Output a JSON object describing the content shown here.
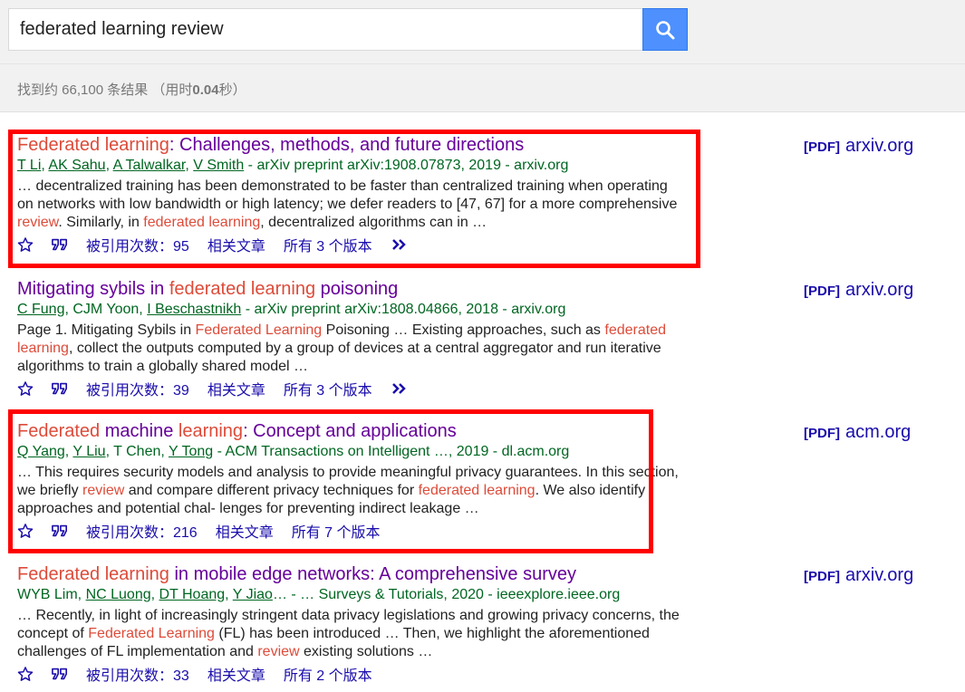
{
  "search": {
    "query": "federated learning review"
  },
  "stats": {
    "prefix": "找到约 66,100 条结果 （用时",
    "time": "0.04",
    "suffix": "秒）"
  },
  "results": [
    {
      "title": [
        {
          "t": "Federated learning",
          "hl": true
        },
        {
          "t": ": Challenges, methods, and future directions",
          "hl": false
        }
      ],
      "authors": [
        {
          "t": "T Li",
          "u": true
        },
        {
          "t": ", ",
          "u": false
        },
        {
          "t": "AK Sahu",
          "u": true
        },
        {
          "t": ", ",
          "u": false
        },
        {
          "t": "A Talwalkar",
          "u": true
        },
        {
          "t": ", ",
          "u": false
        },
        {
          "t": "V Smith",
          "u": true
        },
        {
          "t": " - arXiv preprint arXiv:1908.07873, 2019 - arxiv.org",
          "u": false
        }
      ],
      "snippet": [
        {
          "t": "… decentralized training has been demonstrated to be faster than centralized training when operating on networks with low bandwidth or high latency; we defer readers to [47, 67] for a more comprehensive ",
          "hl": false
        },
        {
          "t": "review",
          "hl": true
        },
        {
          "t": ". Similarly, in ",
          "hl": false
        },
        {
          "t": "federated learning",
          "hl": true
        },
        {
          "t": ", decentralized algorithms can in …",
          "hl": false
        }
      ],
      "cited": "被引用次数：95",
      "related": "相关文章",
      "versions": "所有 3 个版本",
      "more": true,
      "pdf_tag": "[PDF]",
      "pdf_host": "arxiv.org"
    },
    {
      "title": [
        {
          "t": "Mitigating sybils in ",
          "hl": false
        },
        {
          "t": "federated learning",
          "hl": true
        },
        {
          "t": " poisoning",
          "hl": false
        }
      ],
      "authors": [
        {
          "t": "C Fung",
          "u": true
        },
        {
          "t": ", CJM Yoon, ",
          "u": false
        },
        {
          "t": "I Beschastnikh",
          "u": true
        },
        {
          "t": " - arXiv preprint arXiv:1808.04866, 2018 - arxiv.org",
          "u": false
        }
      ],
      "snippet": [
        {
          "t": "Page 1. Mitigating Sybils in ",
          "hl": false
        },
        {
          "t": "Federated Learning",
          "hl": true
        },
        {
          "t": " Poisoning … Existing approaches, such as ",
          "hl": false
        },
        {
          "t": "federated learning",
          "hl": true
        },
        {
          "t": ", collect the outputs computed by a group of devices at a central aggregator and run iterative algorithms to train a globally shared model …",
          "hl": false
        }
      ],
      "cited": "被引用次数：39",
      "related": "相关文章",
      "versions": "所有 3 个版本",
      "more": true,
      "pdf_tag": "[PDF]",
      "pdf_host": "arxiv.org"
    },
    {
      "title": [
        {
          "t": "Federated",
          "hl": true
        },
        {
          "t": " machine ",
          "hl": false
        },
        {
          "t": "learning",
          "hl": true
        },
        {
          "t": ": Concept and applications",
          "hl": false
        }
      ],
      "authors": [
        {
          "t": "Q Yang",
          "u": true
        },
        {
          "t": ", ",
          "u": false
        },
        {
          "t": "Y Liu",
          "u": true
        },
        {
          "t": ", T Chen, ",
          "u": false
        },
        {
          "t": "Y Tong",
          "u": true
        },
        {
          "t": " - ACM Transactions on Intelligent …, 2019 - dl.acm.org",
          "u": false
        }
      ],
      "snippet": [
        {
          "t": "… This requires security models and analysis to provide meaningful privacy guarantees. In this section, we briefly ",
          "hl": false
        },
        {
          "t": "review",
          "hl": true
        },
        {
          "t": " and compare different privacy techniques for ",
          "hl": false
        },
        {
          "t": "federated learning",
          "hl": true
        },
        {
          "t": ". We also identify approaches and potential chal- lenges for preventing indirect leakage …",
          "hl": false
        }
      ],
      "cited": "被引用次数：216",
      "related": "相关文章",
      "versions": "所有 7 个版本",
      "more": false,
      "pdf_tag": "[PDF]",
      "pdf_host": "acm.org"
    },
    {
      "title": [
        {
          "t": "Federated learning",
          "hl": true
        },
        {
          "t": " in mobile edge networks: A comprehensive survey",
          "hl": false
        }
      ],
      "authors": [
        {
          "t": "WYB Lim, ",
          "u": false
        },
        {
          "t": "NC Luong",
          "u": true
        },
        {
          "t": ", ",
          "u": false
        },
        {
          "t": "DT Hoang",
          "u": true
        },
        {
          "t": ", ",
          "u": false
        },
        {
          "t": "Y Jiao",
          "u": true
        },
        {
          "t": "… - … Surveys & Tutorials, 2020 - ieeexplore.ieee.org",
          "u": false
        }
      ],
      "snippet": [
        {
          "t": "… Recently, in light of increasingly stringent data privacy legislations and growing privacy concerns, the concept of ",
          "hl": false
        },
        {
          "t": "Federated Learning",
          "hl": true
        },
        {
          "t": " (FL) has been introduced … Then, we highlight the aforementioned challenges of FL implementation and ",
          "hl": false
        },
        {
          "t": "review",
          "hl": true
        },
        {
          "t": " existing solutions …",
          "hl": false
        }
      ],
      "cited": "被引用次数：33",
      "related": "相关文章",
      "versions": "所有 2 个版本",
      "more": false,
      "pdf_tag": "[PDF]",
      "pdf_host": "arxiv.org"
    }
  ],
  "icons": {
    "search": "search-icon",
    "save": "star-icon",
    "cite": "quote-icon",
    "more": "double-chevron-icon"
  },
  "colors": {
    "title": "#660099",
    "highlight": "#dd4b39",
    "author": "#006621",
    "link": "#1a0dab",
    "annotation_box": "#ff0000",
    "search_button": "#4d90fe"
  }
}
